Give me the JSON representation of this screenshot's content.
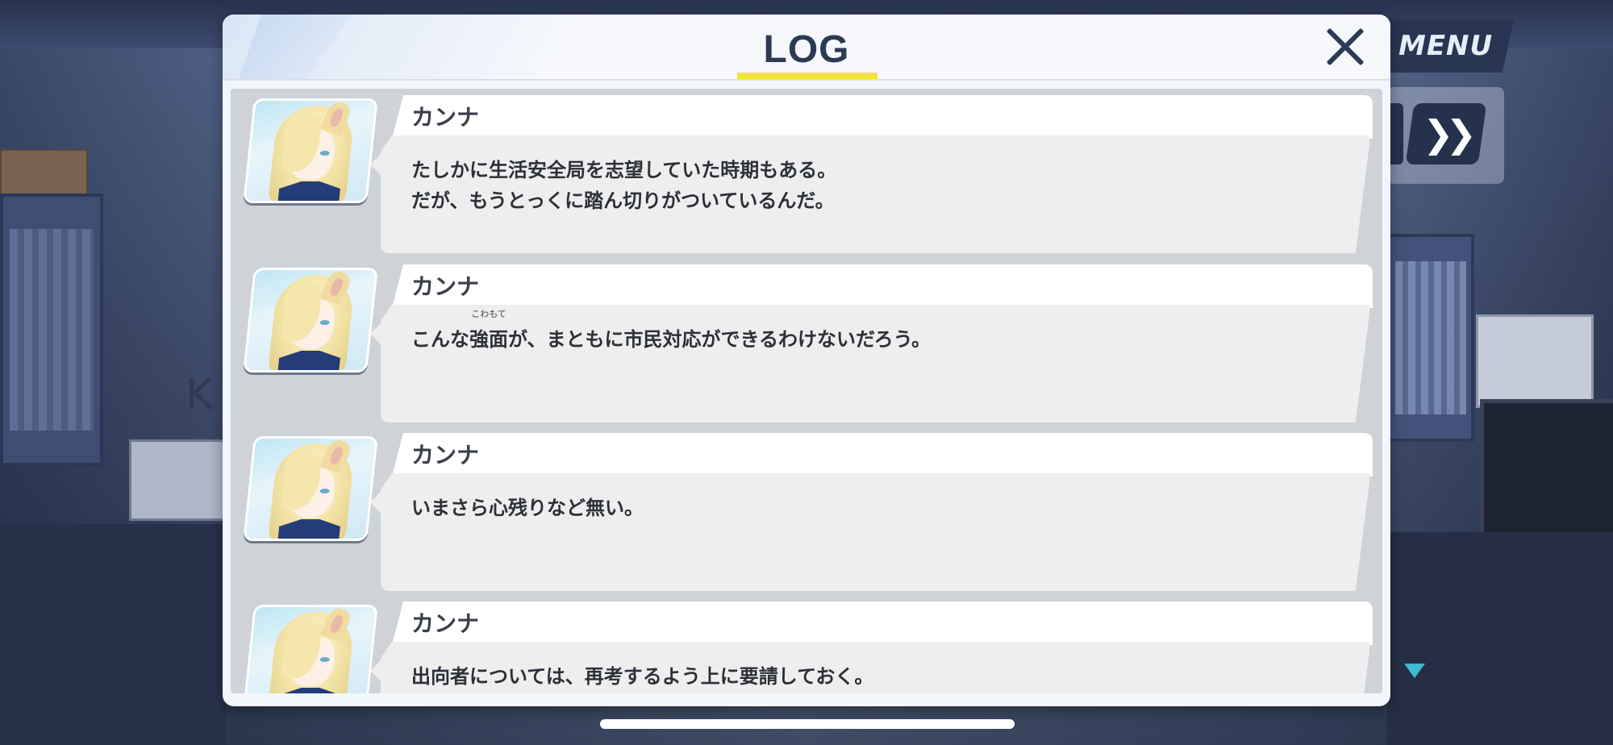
{
  "background": {
    "sign_letter": "K"
  },
  "hud": {
    "menu_label": "MENU",
    "fast_forward_icon": "double-chevron-right-icon",
    "scroll_indicator_icon": "triangle-down-icon"
  },
  "dialog": {
    "title": "LOG",
    "close_icon": "close-icon",
    "entries": [
      {
        "speaker": "カンナ",
        "text": "たしかに生活安全局を志望していた時期もある。\nだが、もうとっくに踏ん切りがついているんだ。"
      },
      {
        "speaker": "カンナ",
        "text_before": "こんな",
        "ruby_base": "強面",
        "ruby_text": "こわもて",
        "text_after": "が、まともに市民対応ができるわけないだろう。"
      },
      {
        "speaker": "カンナ",
        "text": "いまさら心残りなど無い。"
      },
      {
        "speaker": "カンナ",
        "text": "出向者については、再考するよう上に要請しておく。"
      }
    ]
  },
  "colors": {
    "title_underline": "#f4e13a",
    "dark_navy": "#2d3a55",
    "scroll_arrow": "#3dbbd0"
  }
}
